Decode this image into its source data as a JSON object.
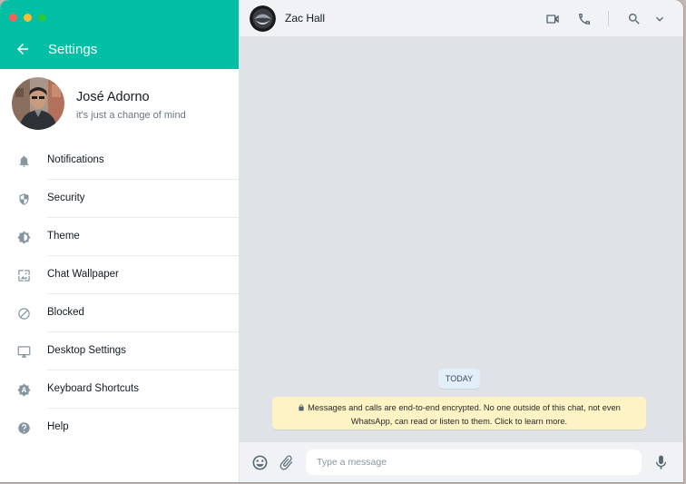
{
  "settings": {
    "title": "Settings",
    "profile": {
      "name": "José Adorno",
      "status": "it's just a change of mind"
    },
    "menu": [
      {
        "label": "Notifications",
        "icon": "bell-icon"
      },
      {
        "label": "Security",
        "icon": "shield-icon"
      },
      {
        "label": "Theme",
        "icon": "brightness-icon"
      },
      {
        "label": "Chat Wallpaper",
        "icon": "wallpaper-icon"
      },
      {
        "label": "Blocked",
        "icon": "blocked-icon"
      },
      {
        "label": "Desktop Settings",
        "icon": "monitor-icon"
      },
      {
        "label": "Keyboard Shortcuts",
        "icon": "keyboard-shortcut-icon"
      },
      {
        "label": "Help",
        "icon": "help-icon"
      }
    ]
  },
  "chat": {
    "contact_name": "Zac Hall",
    "date_label": "TODAY",
    "encryption_notice": "Messages and calls are end-to-end encrypted. No one outside of this chat, not even WhatsApp, can read or listen to them. Click to learn more.",
    "input_placeholder": "Type a message"
  },
  "colors": {
    "accent": "#00bfa5",
    "chat_background": "#dfe3e7",
    "banner": "#fdf3c5"
  }
}
